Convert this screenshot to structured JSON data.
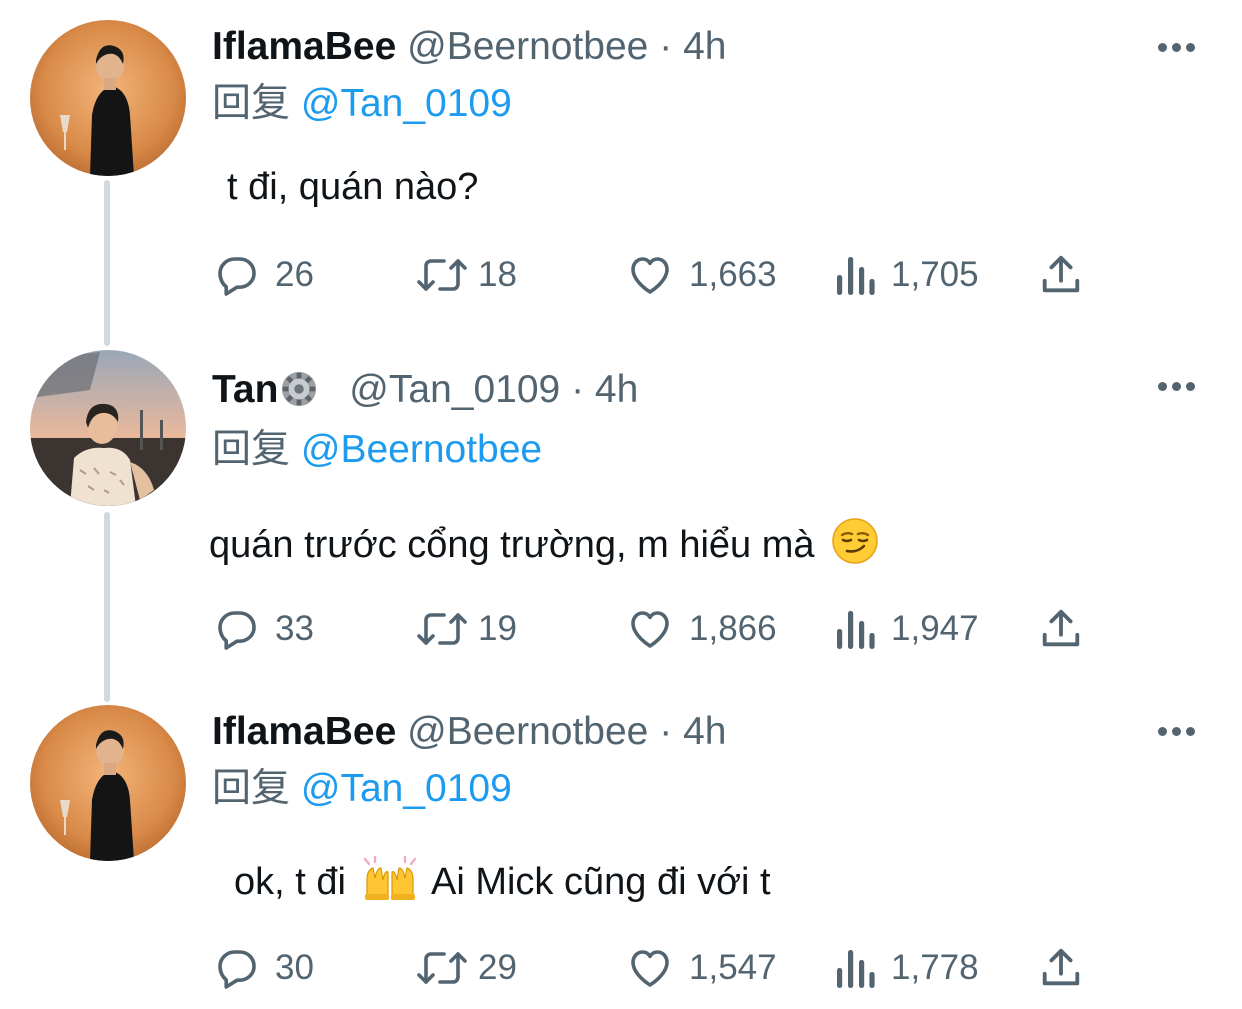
{
  "tweets": [
    {
      "name": "IflamaBee",
      "handle": "@Beernotbee",
      "dot": "·",
      "time": "4h",
      "reply_prefix": "回复",
      "reply_to": "@Tan_0109",
      "text": "t đi, quán nào?",
      "replies": "26",
      "retweets": "18",
      "likes": "1,663",
      "views": "1,705"
    },
    {
      "name": "Tan",
      "handle": "@Tan_0109",
      "dot": "·",
      "time": "4h",
      "reply_prefix": "回复",
      "reply_to": "@Beernotbee",
      "text": "quán trước cổng trường, m hiểu mà",
      "emoji": "smirking-face",
      "replies": "33",
      "retweets": "19",
      "likes": "1,866",
      "views": "1,947"
    },
    {
      "name": "IflamaBee",
      "handle": "@Beernotbee",
      "dot": "·",
      "time": "4h",
      "reply_prefix": "回复",
      "reply_to": "@Tan_0109",
      "text_before": "ok, t đi",
      "emoji": "raising-hands",
      "text_after": "Ai Mick cũng đi với t",
      "replies": "30",
      "retweets": "29",
      "likes": "1,547",
      "views": "1,778"
    }
  ],
  "colors": {
    "text": "#0f1419",
    "secondary": "#536471",
    "link": "#1d9bf0",
    "thread_line": "#cfd9de"
  },
  "icons": [
    "reply-icon",
    "retweet-icon",
    "like-icon",
    "views-icon",
    "share-icon",
    "more-icon",
    "gear-icon"
  ]
}
